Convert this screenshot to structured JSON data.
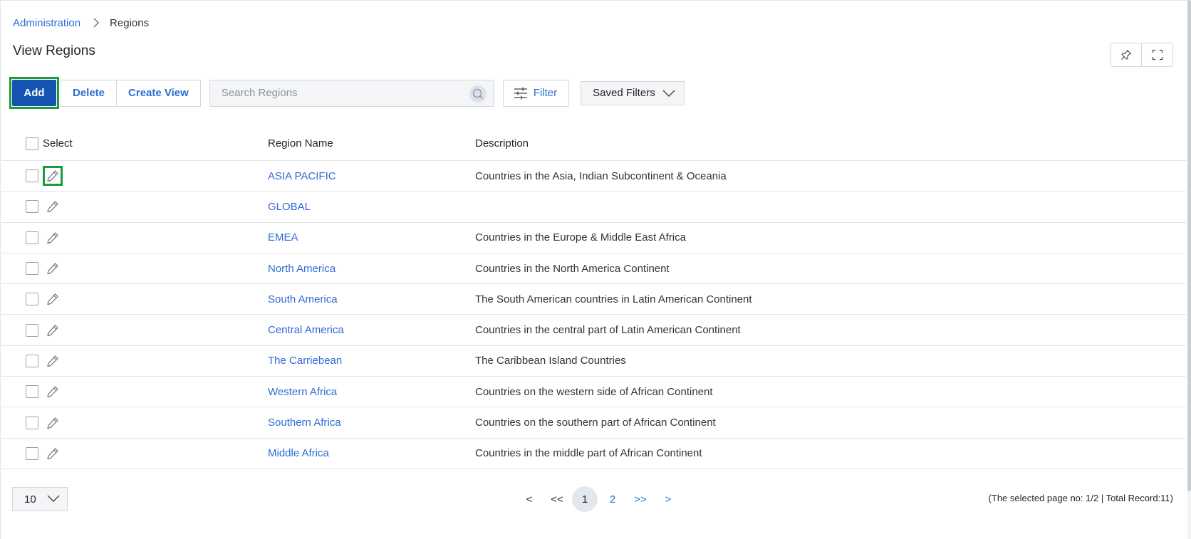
{
  "breadcrumb": {
    "parent": "Administration",
    "current": "Regions"
  },
  "page": {
    "title": "View Regions"
  },
  "toolbar": {
    "add_label": "Add",
    "delete_label": "Delete",
    "create_view_label": "Create View",
    "search_placeholder": "Search Regions",
    "filter_label": "Filter",
    "saved_filters_label": "Saved Filters"
  },
  "table": {
    "headers": {
      "select": "Select",
      "name": "Region Name",
      "description": "Description"
    },
    "rows": [
      {
        "name": "ASIA PACIFIC",
        "description": "Countries in the Asia, Indian Subcontinent & Oceania"
      },
      {
        "name": "GLOBAL",
        "description": ""
      },
      {
        "name": "EMEA",
        "description": "Countries in the Europe & Middle East Africa"
      },
      {
        "name": "North America",
        "description": "Countries in the North America Continent"
      },
      {
        "name": "South America",
        "description": "The South American countries in Latin American Continent"
      },
      {
        "name": "Central America",
        "description": "Countries in the central part of Latin American Continent"
      },
      {
        "name": "The Carriebean",
        "description": "The Caribbean Island Countries"
      },
      {
        "name": "Western Africa",
        "description": "Countries on the western side of African Continent"
      },
      {
        "name": "Southern Africa",
        "description": "Countries on the southern part of African Continent"
      },
      {
        "name": "Middle Africa",
        "description": "Countries in the middle part of African Continent"
      }
    ]
  },
  "pagination": {
    "page_size": "10",
    "prev": "<",
    "first": "<<",
    "pages": [
      "1",
      "2"
    ],
    "last": ">>",
    "next": ">",
    "record_info": "(The selected page no: 1/2 | Total Record:11)"
  },
  "colors": {
    "primary": "#1554b3",
    "link": "#2f6bd6",
    "highlight": "#1e9b3a"
  }
}
